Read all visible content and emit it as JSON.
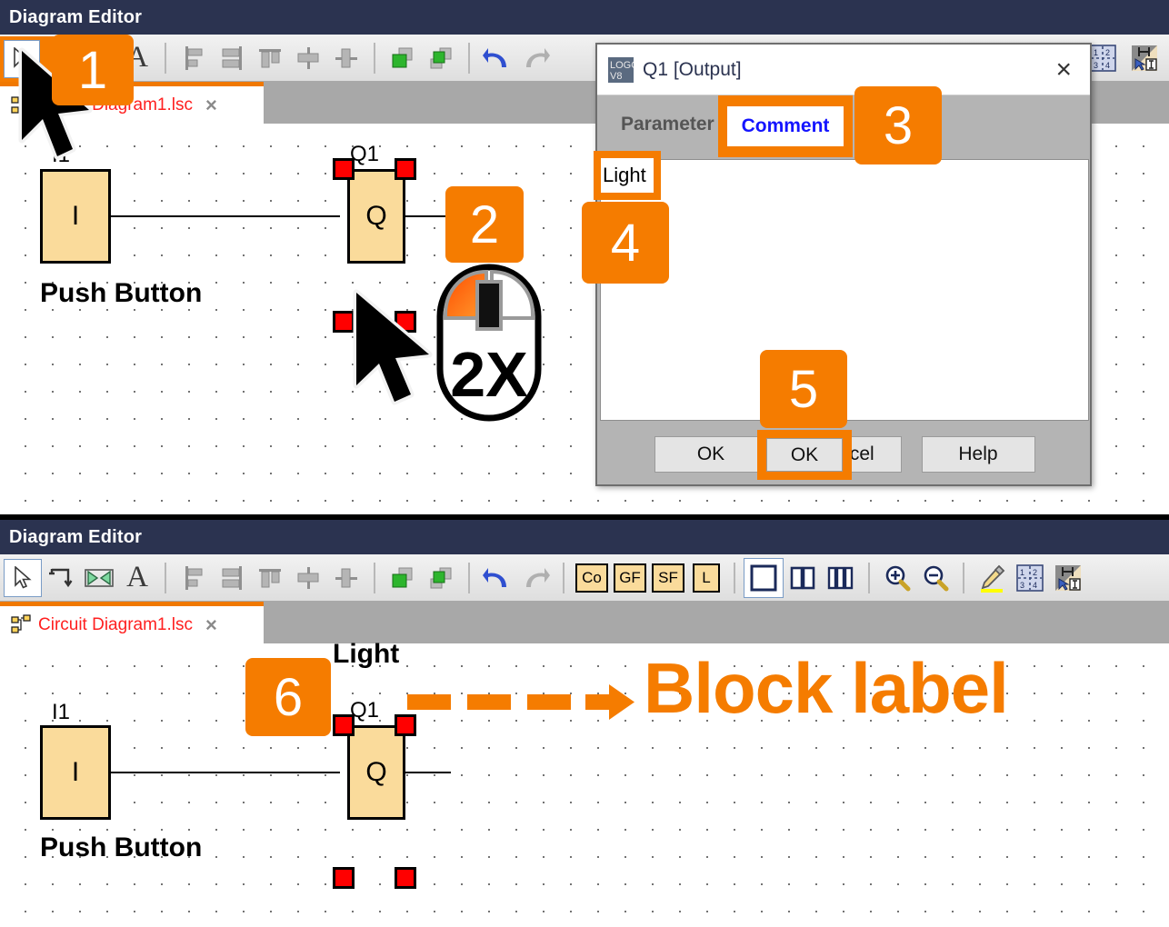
{
  "app": {
    "title": "Diagram Editor"
  },
  "colors": {
    "accent": "#f57c00",
    "titlebar": "#2b3350",
    "block_fill": "#fadb9b",
    "handle": "#ff0000",
    "tab_text": "#ff2020",
    "active_tab_text": "#1414ff"
  },
  "panel_top": {
    "title": "Diagram Editor",
    "tab": {
      "label": "Circuit Diagram1.lsc",
      "close": "×",
      "icon": "block-tree-icon"
    },
    "toolbar": [
      {
        "name": "select-tool",
        "icon": "arrow-cursor-icon",
        "label": "Select",
        "selected": true
      },
      {
        "name": "connect-tool",
        "icon": "connect-line-icon",
        "label": "Connect"
      },
      {
        "name": "cut-connection-tool",
        "icon": "cut-connection-icon",
        "label": "Cut Connection"
      },
      {
        "name": "text-tool",
        "icon": "text-A-icon",
        "label": "Text"
      },
      {
        "name": "align-left",
        "icon": "align-left-icon",
        "label": "Align Left"
      },
      {
        "name": "align-right",
        "icon": "align-right-icon",
        "label": "Align Right"
      },
      {
        "name": "align-top",
        "icon": "align-top-icon",
        "label": "Align Top"
      },
      {
        "name": "align-center-vertical",
        "icon": "align-center-vertical-icon",
        "label": "Center Vertically"
      },
      {
        "name": "align-center-horizontal",
        "icon": "align-center-horizontal-icon",
        "label": "Center Horizontally"
      },
      {
        "name": "bring-to-front",
        "icon": "bring-to-front-icon",
        "label": "Bring to Front"
      },
      {
        "name": "send-to-back",
        "icon": "send-to-back-icon",
        "label": "Send to Back"
      },
      {
        "name": "undo",
        "icon": "undo-arrow-icon",
        "label": "Undo"
      },
      {
        "name": "redo",
        "icon": "redo-arrow-icon",
        "label": "Redo"
      }
    ],
    "toolbar_right": [
      {
        "name": "simulation-table",
        "icon": "simulation-grid-icon",
        "label": "Simulation"
      },
      {
        "name": "selection-tool",
        "icon": "selection-cursor-icon",
        "label": "Selection"
      }
    ],
    "circuit": {
      "input": {
        "name": "I1",
        "symbol": "I",
        "caption": "Push Button"
      },
      "output": {
        "name": "Q1",
        "symbol": "Q",
        "caption": "",
        "selected": true
      }
    }
  },
  "panel_bottom": {
    "title": "Diagram Editor",
    "tab": {
      "label": "Circuit Diagram1.lsc",
      "close": "×",
      "icon": "block-tree-icon"
    },
    "toolbar": [
      {
        "name": "select-tool",
        "icon": "arrow-cursor-icon",
        "label": "Select",
        "selected": true
      },
      {
        "name": "connect-tool",
        "icon": "connect-line-icon",
        "label": "Connect"
      },
      {
        "name": "cut-connection-tool",
        "icon": "cut-connection-icon",
        "label": "Cut Connection"
      },
      {
        "name": "text-tool",
        "icon": "text-A-icon",
        "label": "Text"
      },
      {
        "name": "align-left",
        "icon": "align-left-icon",
        "label": "Align Left"
      },
      {
        "name": "align-right",
        "icon": "align-right-icon",
        "label": "Align Right"
      },
      {
        "name": "align-top",
        "icon": "align-top-icon",
        "label": "Align Top"
      },
      {
        "name": "align-center-vertical",
        "icon": "align-center-vertical-icon",
        "label": "Center Vertically"
      },
      {
        "name": "align-center-horizontal",
        "icon": "align-center-horizontal-icon",
        "label": "Center Horizontally"
      },
      {
        "name": "bring-to-front",
        "icon": "bring-to-front-icon",
        "label": "Bring to Front"
      },
      {
        "name": "send-to-back",
        "icon": "send-to-back-icon",
        "label": "Send to Back"
      },
      {
        "name": "undo",
        "icon": "undo-arrow-icon",
        "label": "Undo"
      },
      {
        "name": "redo",
        "icon": "redo-arrow-icon",
        "label": "Redo"
      }
    ],
    "block_buttons": [
      {
        "name": "constants-button",
        "label": "Co"
      },
      {
        "name": "general-functions-button",
        "label": "GF"
      },
      {
        "name": "special-functions-button",
        "label": "SF"
      },
      {
        "name": "list-button",
        "label": "L"
      }
    ],
    "view_buttons": [
      {
        "name": "single-view-button",
        "icon": "single-pane-icon",
        "selected": true
      },
      {
        "name": "two-pane-view-button",
        "icon": "two-pane-icon",
        "selected": false
      },
      {
        "name": "three-pane-view-button",
        "icon": "three-pane-icon",
        "selected": false
      }
    ],
    "zoom_buttons": [
      {
        "name": "zoom-in-button",
        "icon": "zoom-in-icon"
      },
      {
        "name": "zoom-out-button",
        "icon": "zoom-out-icon"
      }
    ],
    "right_buttons": [
      {
        "name": "highlight-pen-button",
        "icon": "pencil-highlight-icon"
      },
      {
        "name": "simulation-table-button",
        "icon": "simulation-grid-icon"
      },
      {
        "name": "selection-cursor-button",
        "icon": "selection-cursor-icon"
      }
    ],
    "circuit": {
      "input": {
        "name": "I1",
        "symbol": "I",
        "caption": "Push Button"
      },
      "output": {
        "name": "Q1",
        "symbol": "Q",
        "caption": "Light",
        "selected": true
      }
    },
    "annotation": {
      "text": "Block label"
    }
  },
  "dialog": {
    "title": "Q1 [Output]",
    "icon": "logo-soft-comfort-icon",
    "close": "×",
    "tabs": [
      {
        "name": "tab-parameter",
        "label": "Parameter",
        "active": false
      },
      {
        "name": "tab-comment",
        "label": "Comment",
        "active": true
      }
    ],
    "comment_value": "Light",
    "buttons": [
      {
        "name": "ok-button",
        "label": "OK"
      },
      {
        "name": "cancel-button",
        "label": "Cancel"
      },
      {
        "name": "help-button",
        "label": "Help"
      }
    ]
  },
  "badges": [
    {
      "n": "1",
      "target": "select-tool"
    },
    {
      "n": "2",
      "target": "output-block-double-click"
    },
    {
      "n": "3",
      "target": "comment-tab"
    },
    {
      "n": "4",
      "target": "comment-text-field"
    },
    {
      "n": "5",
      "target": "ok-button"
    },
    {
      "n": "6",
      "target": "block-label-on-canvas"
    }
  ],
  "mouse_hint": {
    "label": "2X",
    "name": "double-click-mouse-icon"
  }
}
